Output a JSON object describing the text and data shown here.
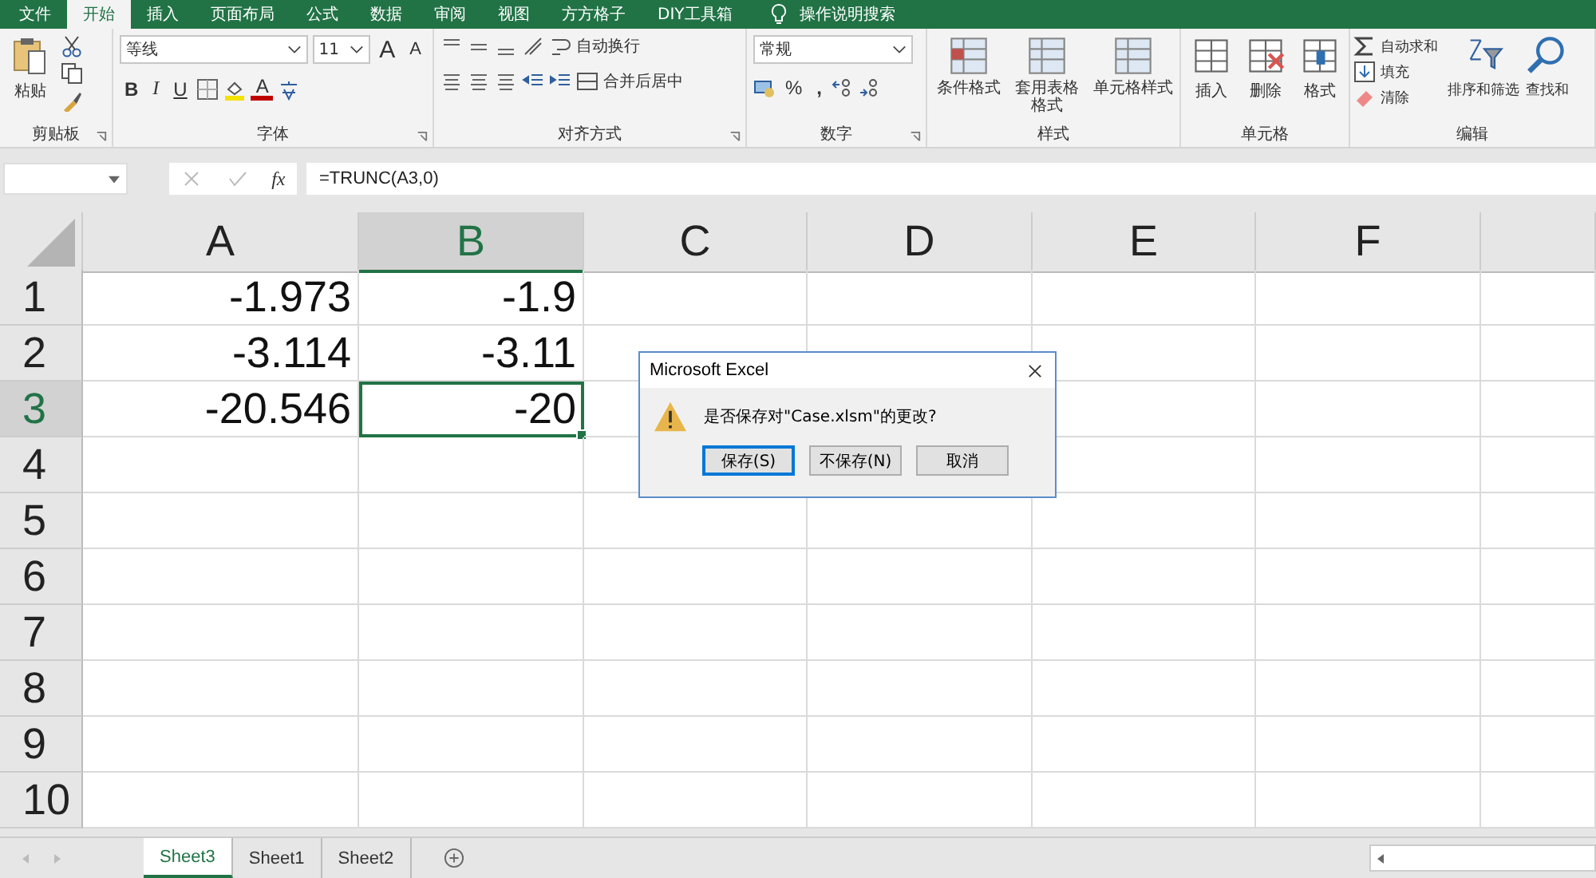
{
  "menu_tabs": [
    {
      "label": "文件",
      "selected": false
    },
    {
      "label": "开始",
      "selected": true
    },
    {
      "label": "插入",
      "selected": false
    },
    {
      "label": "页面布局",
      "selected": false
    },
    {
      "label": "公式",
      "selected": false
    },
    {
      "label": "数据",
      "selected": false
    },
    {
      "label": "审阅",
      "selected": false
    },
    {
      "label": "视图",
      "selected": false
    },
    {
      "label": "方方格子",
      "selected": false
    },
    {
      "label": "DIY工具箱",
      "selected": false
    }
  ],
  "tell_me": {
    "placeholder": "操作说明搜索"
  },
  "ribbon": {
    "clipboard": {
      "paste": "粘贴",
      "label": "剪贴板"
    },
    "font": {
      "name": "等线",
      "size": "11",
      "grow": "A",
      "shrink": "A",
      "bold": "B",
      "italic": "I",
      "underline": "U",
      "font_color_letter": "A",
      "label": "字体"
    },
    "alignment": {
      "wrap": "自动换行",
      "merge": "合并后居中",
      "label": "对齐方式"
    },
    "number": {
      "format": "常规",
      "percent": "%",
      "comma": ",",
      "label": "数字"
    },
    "styles": {
      "items": [
        "条件格式",
        "套用表格格式",
        "单元格样式"
      ],
      "label": "样式"
    },
    "cells": {
      "items": [
        "插入",
        "删除",
        "格式"
      ],
      "label": "单元格"
    },
    "editing": {
      "autosum": "自动求和",
      "fill": "填充",
      "clear": "清除",
      "sort": "排序和筛选",
      "find": "查找和",
      "label": "编辑"
    }
  },
  "formula_bar": {
    "fx": "fx",
    "formula": "=TRUNC(A3,0)"
  },
  "columns": [
    {
      "label": "A",
      "selected": false
    },
    {
      "label": "B",
      "selected": true
    },
    {
      "label": "C",
      "selected": false
    },
    {
      "label": "D",
      "selected": false
    },
    {
      "label": "E",
      "selected": false
    },
    {
      "label": "F",
      "selected": false
    }
  ],
  "rows": [
    {
      "label": "1",
      "selected": false,
      "cells": [
        {
          "value": "-1.973",
          "selected": false
        },
        {
          "value": "-1.9",
          "selected": false
        }
      ]
    },
    {
      "label": "2",
      "selected": false,
      "cells": [
        {
          "value": "-3.114",
          "selected": false
        },
        {
          "value": "-3.11",
          "selected": false
        }
      ]
    },
    {
      "label": "3",
      "selected": true,
      "cells": [
        {
          "value": "-20.546",
          "selected": false
        },
        {
          "value": "-20",
          "selected": true
        }
      ]
    },
    {
      "label": "4",
      "selected": false,
      "cells": []
    },
    {
      "label": "5",
      "selected": false,
      "cells": []
    },
    {
      "label": "6",
      "selected": false,
      "cells": []
    },
    {
      "label": "7",
      "selected": false,
      "cells": []
    },
    {
      "label": "8",
      "selected": false,
      "cells": []
    },
    {
      "label": "9",
      "selected": false,
      "cells": []
    },
    {
      "label": "10",
      "selected": false,
      "cells": []
    }
  ],
  "sheet_tabs": [
    {
      "label": "Sheet3",
      "selected": true
    },
    {
      "label": "Sheet1",
      "selected": false
    },
    {
      "label": "Sheet2",
      "selected": false
    }
  ],
  "dialog": {
    "title": "Microsoft Excel",
    "message": "是否保存对\"Case.xlsm\"的更改?",
    "buttons": [
      {
        "label": "保存(S)",
        "default": true
      },
      {
        "label": "不保存(N)",
        "default": false
      },
      {
        "label": "取消",
        "default": false
      }
    ]
  }
}
